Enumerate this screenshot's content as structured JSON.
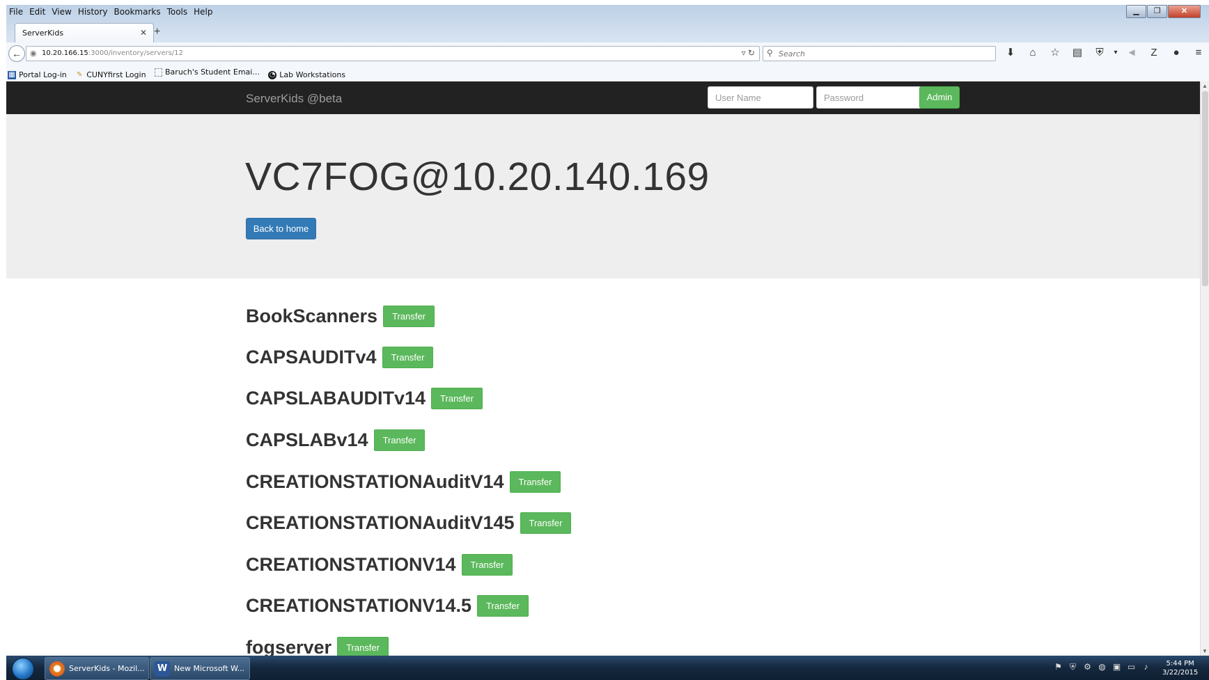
{
  "browser": {
    "menu": [
      "File",
      "Edit",
      "View",
      "History",
      "Bookmarks",
      "Tools",
      "Help"
    ],
    "tab_title": "ServerKids",
    "url_host": "10.20.166.15",
    "url_rest": ":3000/inventory/servers/12",
    "search_placeholder": "Search",
    "bookmarks": [
      "Portal Log-in",
      "CUNYfirst Login",
      "Baruch's Student Emai...",
      "Lab Workstations"
    ],
    "toolbar_icons": [
      "download-icon",
      "home-icon",
      "star-icon",
      "reading-list-icon",
      "extension-icon",
      "menu-dropdown-icon",
      "send-icon",
      "zotero-icon",
      "chat-icon",
      "hamburger-menu-icon"
    ]
  },
  "site": {
    "brand": "ServerKids @beta",
    "username_placeholder": "User Name",
    "password_placeholder": "Password",
    "admin_label": "Admin",
    "title": "VC7FOG@10.20.140.169",
    "back_label": "Back to home",
    "transfer_label": "Transfer",
    "images": [
      "BookScanners",
      "CAPSAUDITv4",
      "CAPSLABAUDITv14",
      "CAPSLABv14",
      "CREATIONSTATIONAuditV14",
      "CREATIONSTATIONAuditV145",
      "CREATIONSTATIONV14",
      "CREATIONSTATIONV14.5",
      "fogserver"
    ]
  },
  "taskbar": {
    "items": [
      "ServerKids - Mozil...",
      "New Microsoft W..."
    ],
    "time": "5:44 PM",
    "date": "3/22/2015"
  },
  "colors": {
    "navbar": "#222222",
    "jumbotron": "#eeeeee",
    "success": "#5cb85c",
    "primary": "#337ab7"
  }
}
